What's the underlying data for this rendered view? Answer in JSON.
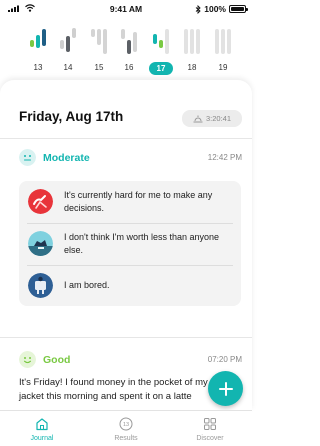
{
  "status_bar": {
    "time": "9:41 AM",
    "battery": "100%",
    "battery_level": 1.0
  },
  "week": {
    "days": [
      {
        "num": "13",
        "active": false
      },
      {
        "num": "14",
        "active": false
      },
      {
        "num": "15",
        "active": false
      },
      {
        "num": "16",
        "active": false
      },
      {
        "num": "17",
        "active": true
      },
      {
        "num": "18",
        "active": false
      },
      {
        "num": "19",
        "active": false
      }
    ]
  },
  "journal": {
    "date_title": "Friday, Aug 17th",
    "sleep_time": "3:20:41",
    "entries": [
      {
        "mood": "Moderate",
        "time": "12:42 PM",
        "color": "#12b5b0",
        "thoughts": [
          {
            "text": "It's currently hard for me to make any decisions.",
            "icon": "decision-icon"
          },
          {
            "text": "I don't think I'm worth less than anyone else.",
            "icon": "worth-icon"
          },
          {
            "text": "I am bored.",
            "icon": "bored-icon"
          }
        ]
      },
      {
        "mood": "Good",
        "time": "07:20 PM",
        "color": "#7ac943",
        "note": "It's Friday! I found money in the pocket of my jacket this morning and spent it on a latte"
      }
    ]
  },
  "fab": {
    "label": "+"
  },
  "tabs": [
    {
      "label": "Journal",
      "icon": "home-icon",
      "active": true
    },
    {
      "label": "Results",
      "icon": "calendar-icon",
      "badge": "13",
      "active": false
    },
    {
      "label": "Discover",
      "icon": "grid-icon",
      "active": false
    }
  ],
  "colors": {
    "accent": "#12b5b0",
    "good": "#7ac943",
    "moderate": "#12b5b0"
  }
}
